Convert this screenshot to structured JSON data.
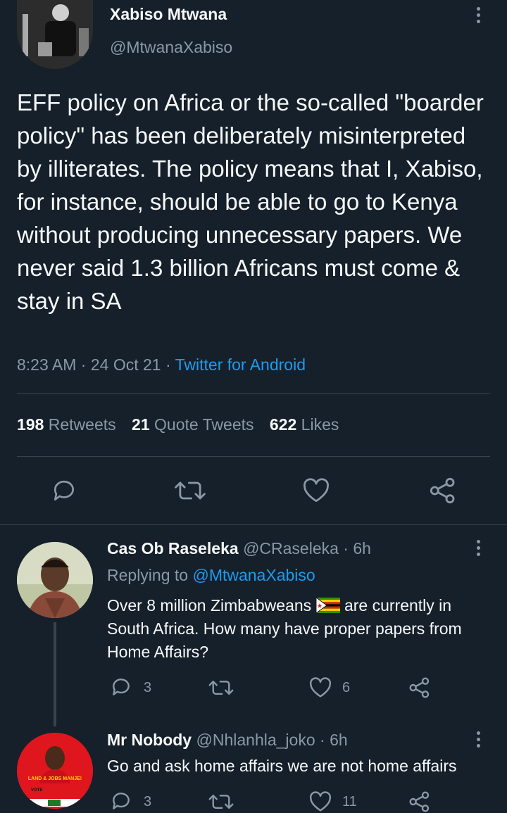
{
  "main_tweet": {
    "author_name": "Xabiso Mtwana",
    "author_handle": "@MtwanaXabiso",
    "text": "EFF policy on Africa or the so-called \"boarder policy\" has been deliberately misinterpreted by illiterates. The policy means that I, Xabiso, for instance, should be able to go to Kenya without producing unnecessary papers. We never said 1.3 billion Africans must come & stay in SA",
    "time": "8:23 AM",
    "date": "24 Oct 21",
    "source": "Twitter for Android",
    "stats": {
      "retweets_count": "198",
      "retweets_label": "Retweets",
      "quotes_count": "21",
      "quotes_label": "Quote Tweets",
      "likes_count": "622",
      "likes_label": "Likes"
    }
  },
  "replies": [
    {
      "author_name": "Cas Ob Raseleka",
      "author_handle": "@CRaseleka",
      "age": "6h",
      "replying_label": "Replying to",
      "replying_to": "@MtwanaXabiso",
      "text_before_flag": "Over 8 million Zimbabweans",
      "text_after_flag": "are currently in South Africa. How many have proper papers from Home Affairs?",
      "reply_count": "3",
      "like_count": "6"
    },
    {
      "author_name": "Mr Nobody",
      "author_handle": "@Nhlanhla_joko",
      "age": "6h",
      "text": "Go and ask home affairs we are not home affairs",
      "reply_count": "3",
      "like_count": "11",
      "avatar_caption": "LAND & JOBS MANJE!",
      "avatar_vote": "VOTE"
    }
  ],
  "separators": {
    "dot": "·"
  },
  "colors": {
    "background": "#15202b",
    "accent": "#1d9bf0",
    "muted": "#8b98a5",
    "text": "#f7f9f9"
  }
}
